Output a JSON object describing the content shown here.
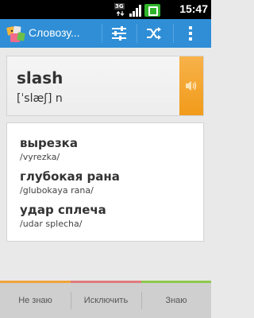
{
  "status_bar": {
    "network_label": "3G",
    "time": "15:47"
  },
  "action_bar": {
    "title": "Словозу...",
    "icons": [
      "app-logo-icon",
      "filter-icon",
      "shuffle-icon",
      "overflow-menu-icon"
    ],
    "background": "#2f8ed6"
  },
  "word": {
    "text": "slash",
    "transcription": "[ˈslæʃ] n"
  },
  "translations": [
    {
      "word": "вырезка",
      "translit": "/vyrezka/"
    },
    {
      "word": "глубокая рана",
      "translit": "/glubokaya rana/"
    },
    {
      "word": "удар сплеча",
      "translit": "/udar splecha/"
    }
  ],
  "bottom_bar": {
    "dont_know_label": "Не знаю",
    "exclude_label": "Исключить",
    "know_label": "Знаю",
    "colors": {
      "dont_know": "#f0a33a",
      "exclude": "#e07b7b",
      "know": "#8fc84d"
    }
  }
}
